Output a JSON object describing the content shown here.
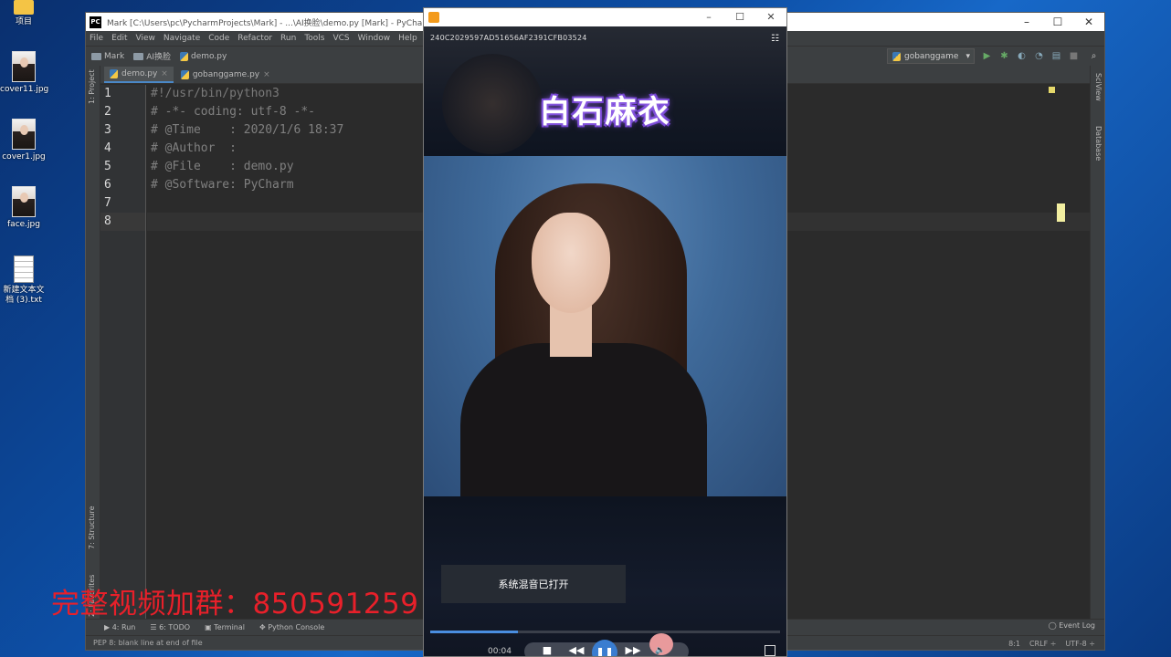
{
  "desktop": {
    "icons": [
      {
        "label": "项目",
        "kind": "folder"
      },
      {
        "label": "cover11.jpg",
        "kind": "photo"
      },
      {
        "label": "cover1.jpg",
        "kind": "photo"
      },
      {
        "label": "face.jpg",
        "kind": "photo"
      },
      {
        "label": "新建文本文档 (3).txt",
        "kind": "text"
      }
    ]
  },
  "ide": {
    "title": "Mark [C:\\Users\\pc\\PycharmProjects\\Mark] - ...\\AI换脸\\demo.py [Mark] - PyCharm",
    "logo": "PC",
    "menu": [
      "File",
      "Edit",
      "View",
      "Navigate",
      "Code",
      "Refactor",
      "Run",
      "Tools",
      "VCS",
      "Window",
      "Help"
    ],
    "breadcrumb": [
      "Mark",
      "AI换脸",
      "demo.py"
    ],
    "run_config": "gobanggame",
    "tabs": [
      {
        "label": "demo.py",
        "active": true
      },
      {
        "label": "gobanggame.py",
        "active": false
      }
    ],
    "left_strip": {
      "project": "1: Project",
      "structure": "7: Structure",
      "favorites": "2: Favorites"
    },
    "right_strip": {
      "scview": "SciView",
      "database": "Database"
    },
    "lines": [
      {
        "n": "1",
        "text": "#!/usr/bin/python3"
      },
      {
        "n": "2",
        "text": "# -*- coding: utf-8 -*-"
      },
      {
        "n": "3",
        "text": "# @Time    : 2020/1/6 18:37"
      },
      {
        "n": "4",
        "text": "# @Author  :"
      },
      {
        "n": "5",
        "text": "# @File    : demo.py"
      },
      {
        "n": "6",
        "text": "# @Software: PyCharm"
      },
      {
        "n": "7",
        "text": ""
      },
      {
        "n": "8",
        "text": ""
      }
    ],
    "bottom_tools": [
      "4: Run",
      "6: TODO",
      "Terminal",
      "Python Console"
    ],
    "event_log": "Event Log",
    "status_message": "PEP 8: blank line at end of file",
    "status_right": [
      "8:1",
      "CRLF ÷",
      "UTF-8 ÷"
    ]
  },
  "player": {
    "filename": "240C2029597AD51656AF2391CFB03524",
    "caption": "白石麻衣",
    "toast": "系统混音已打开",
    "time": "00:04",
    "progress": 0.25,
    "colors": {
      "accent": "#4a8ee0",
      "caption_glow": "#6c3cc9"
    }
  },
  "promo": {
    "text": "完整视频加群：850591259",
    "color": "#e8202a"
  }
}
